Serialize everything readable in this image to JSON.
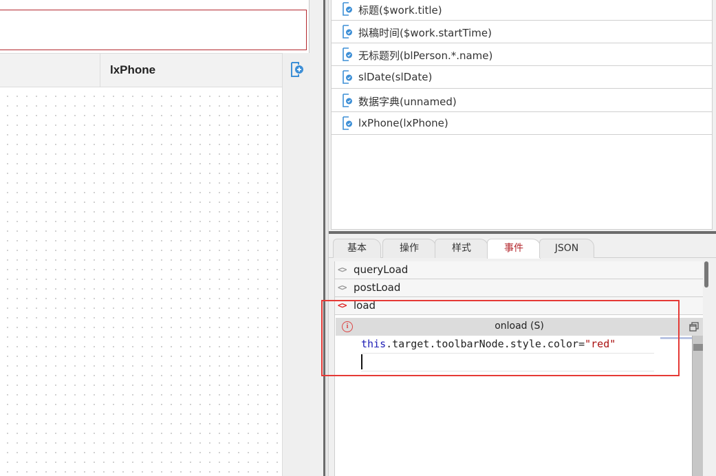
{
  "designer": {
    "column_header": "lxPhone"
  },
  "fields": [
    {
      "label": "标题($work.title)"
    },
    {
      "label": "拟稿时间($work.startTime)"
    },
    {
      "label": "无标题列(blPerson.*.name)"
    },
    {
      "label": "slDate(slDate)"
    },
    {
      "label": "数据字典(unnamed)"
    },
    {
      "label": "lxPhone(lxPhone)"
    }
  ],
  "tabs": [
    {
      "label": "基本"
    },
    {
      "label": "操作"
    },
    {
      "label": "样式"
    },
    {
      "label": "事件",
      "active": true
    },
    {
      "label": "JSON"
    }
  ],
  "events": [
    {
      "label": "queryLoad"
    },
    {
      "label": "postLoad"
    },
    {
      "label": "load",
      "active": true
    }
  ],
  "editor": {
    "title": "onload (S)",
    "code_keyword": "this",
    "code_middle": ".target.toolbarNode.style.color=",
    "code_string": "\"red\""
  },
  "colors": {
    "accent_red": "#b3262c",
    "highlight_red": "#e53935",
    "icon_blue": "#3d8fd6"
  },
  "icons": {
    "field": "field-link-icon",
    "add": "add-field-icon",
    "event": "code-brackets-icon",
    "info": "info-icon",
    "restore": "restore-window-icon"
  }
}
